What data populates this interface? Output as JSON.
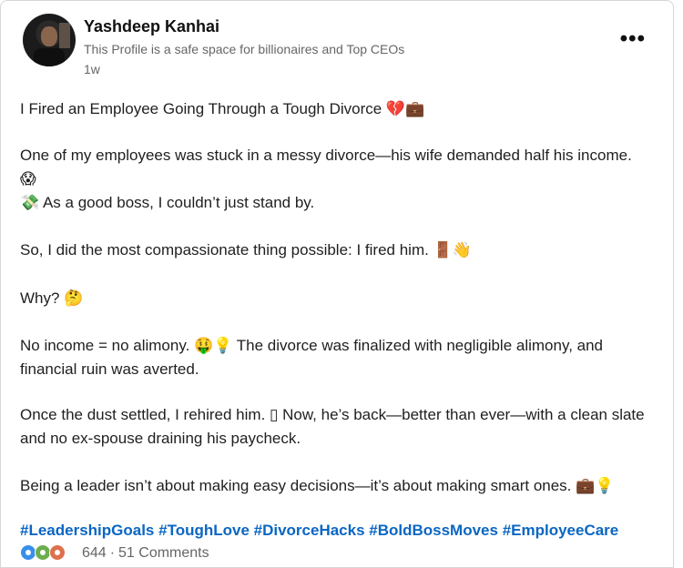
{
  "author": {
    "name": "Yashdeep Kanhai",
    "tagline": "This Profile is a safe space for billionaires and Top CEOs",
    "age": "1w"
  },
  "post": {
    "line_1": "I Fired an Employee Going Through a Tough Divorce 💔💼",
    "line_2a": "One of my employees was stuck in a messy divorce—his wife demanded half his income. 😱",
    "line_2b": "💸 As a good boss, I couldn’t just stand by.",
    "line_3": "So, I did the most compassionate thing possible: I fired him. 🚪👋",
    "line_4": "Why? 🤔",
    "line_5a": "No income = no alimony. 🤑💡 The divorce was finalized with negligible alimony, and",
    "line_5b": "financial ruin was averted.",
    "line_6a": "Once the dust settled, I rehired him. ▯ Now, he’s back—better than ever—with a clean slate",
    "line_6b": "and no ex-spouse draining his paycheck.",
    "line_7": "Being a leader isn’t about making easy decisions—it’s about making smart ones. 💼💡",
    "hashtags": "#LeadershipGoals #ToughLove #DivorceHacks #BoldBossMoves #EmployeeCare"
  },
  "engagement": {
    "reactions_count": "644",
    "separator": "·",
    "comments": "51 Comments"
  },
  "icons": {
    "more": "more-icon",
    "reactions": [
      "like-icon",
      "celebrate-icon",
      "love-icon"
    ]
  },
  "colors": {
    "hashtag": "#0a66c2",
    "muted": "#666666",
    "like": "#378fe9",
    "celebrate": "#6dae4f",
    "love": "#df704d"
  }
}
